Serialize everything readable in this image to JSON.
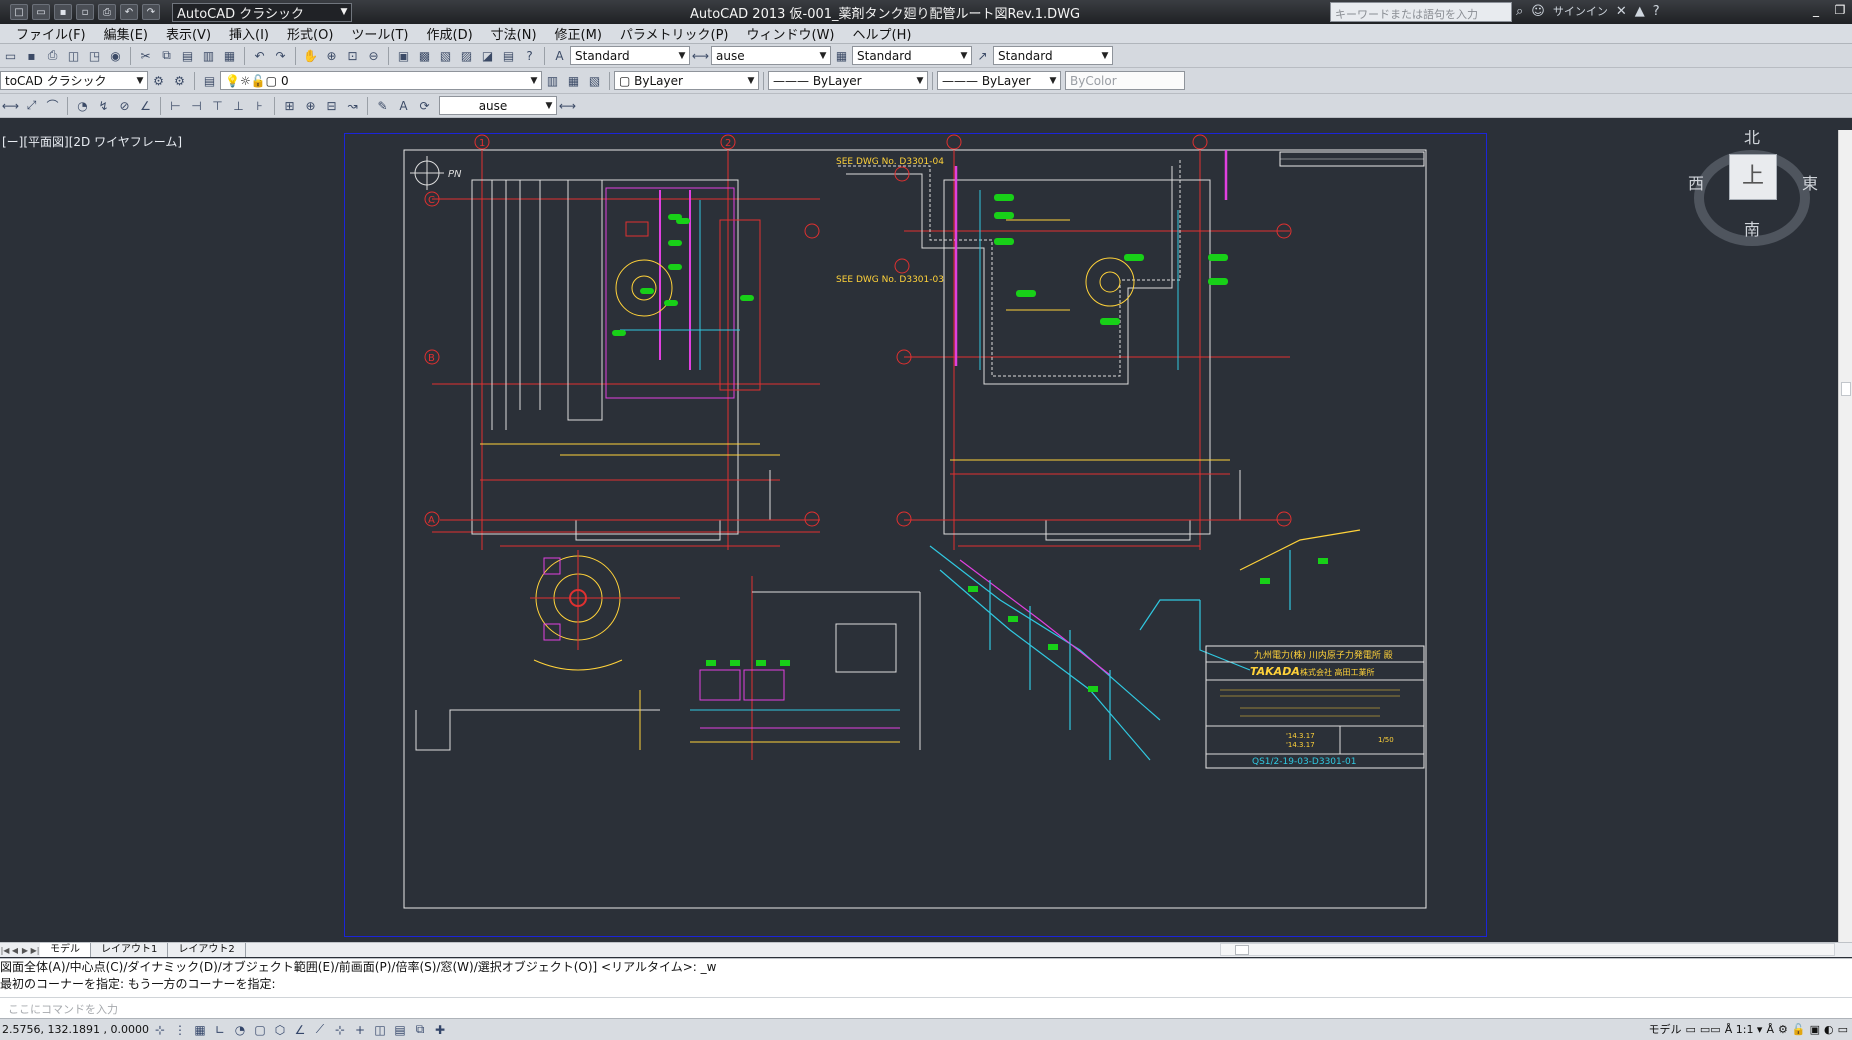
{
  "window": {
    "title": "AutoCAD 2013    仮-001_薬剤タンク廻り配管ルート図Rev.1.DWG",
    "workspace": "AutoCAD クラシック",
    "search_placeholder": "キーワードまたは語句を入力",
    "signin": "サインイン",
    "help": "?"
  },
  "menu": [
    "ファイル(F)",
    "編集(E)",
    "表示(V)",
    "挿入(I)",
    "形式(O)",
    "ツール(T)",
    "作成(D)",
    "寸法(N)",
    "修正(M)",
    "パラメトリック(P)",
    "ウィンドウ(W)",
    "ヘルプ(H)"
  ],
  "toolbar": {
    "text_style": "Standard",
    "dim_style": "ause",
    "table_style": "Standard",
    "multileader_style": "Standard",
    "workspace2": "toCAD クラシック",
    "layer": "0",
    "color": "ByLayer",
    "linetype": "ByLayer",
    "lineweight": "ByLayer",
    "plotstyle": "ByColor",
    "dim_style2": "ause"
  },
  "viewport": {
    "caption": "[ー][平面図][2D ワイヤフレーム]",
    "viewcube": {
      "north": "北",
      "south": "南",
      "east": "東",
      "west": "西",
      "face": "上"
    },
    "drawing": {
      "see_dwg_1": "SEE DWG No. D3301-04",
      "see_dwg_2": "SEE DWG No. D3301-03",
      "pn_label": "PN",
      "title_block": {
        "client": "九州電力(株) 川内原子力発電所 殿",
        "company_logo": "TAKADA",
        "company": "株式会社 高田工業所",
        "drawing_no": "QS1/2-19-03-D3301-01",
        "scale": "1/50",
        "date1": "'14.3.17",
        "date2": "'14.3.17"
      },
      "grid_labels": [
        "A",
        "B",
        "C",
        "1",
        "2"
      ]
    }
  },
  "tabs": {
    "model": "モデル",
    "layout1": "レイアウト1",
    "layout2": "レイアウト2"
  },
  "command": {
    "line1": "図面全体(A)/中心点(C)/ダイナミック(D)/オブジェクト範囲(E)/前画面(P)/倍率(S)/窓(W)/選択オブジェクト(O)] <リアルタイム>: _w",
    "line2": "最初のコーナーを指定: もう一方のコーナーを指定:",
    "input_placeholder": "ここにコマンドを入力"
  },
  "status": {
    "coords": "2.5756, 132.1891 , 0.0000",
    "model": "モデル",
    "scale": "1:1"
  }
}
